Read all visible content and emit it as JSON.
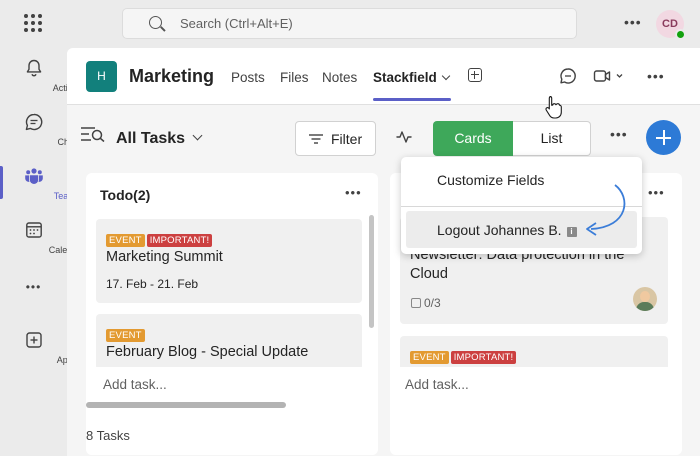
{
  "topbar": {
    "search_placeholder": "Search (Ctrl+Alt+E)",
    "more_label": "•••",
    "user_initials": "CD"
  },
  "rail": {
    "items": [
      {
        "label": "Activity",
        "icon": "bell-icon"
      },
      {
        "label": "Chat",
        "icon": "chat-icon"
      },
      {
        "label": "Teams",
        "icon": "teams-icon",
        "active": true
      },
      {
        "label": "Calendar",
        "icon": "calendar-icon"
      },
      {
        "label": "•••",
        "icon": "more-icon"
      },
      {
        "label": "Apps",
        "icon": "apps-icon"
      }
    ]
  },
  "header": {
    "team_initial": "H",
    "team_name": "Marketing",
    "tabs": [
      "Posts",
      "Files",
      "Notes",
      "Stackfield"
    ],
    "active_tab": "Stackfield",
    "more_label": "•••"
  },
  "toolbar": {
    "view_title": "All Tasks",
    "filter_label": "Filter",
    "cards_label": "Cards",
    "list_label": "List",
    "more_label": "•••"
  },
  "menu": {
    "item_1": "Customize Fields",
    "item_2": "Logout Johannes B.",
    "info_glyph": "i"
  },
  "columns": [
    {
      "title": "Todo(2)",
      "more_label": "•••",
      "cards": [
        {
          "badges": [
            "EVENT",
            "IMPORTANT!"
          ],
          "title": "Marketing Summit",
          "date": "17. Feb - 21. Feb"
        },
        {
          "badges": [
            "EVENT"
          ],
          "title": "February Blog - Special Update"
        }
      ],
      "add_task": "Add task..."
    },
    {
      "title": "",
      "more_label": "•••",
      "cards": [
        {
          "title_line_1": "Newsletter: Data protection in the",
          "title_line_2": "Cloud",
          "subtasks": "0/3"
        },
        {
          "badges": [
            "EVENT",
            "IMPORTANT!"
          ]
        }
      ],
      "add_task": "Add task..."
    }
  ],
  "footer": {
    "task_count": "8 Tasks"
  },
  "colors": {
    "accent": "#5b5fc7",
    "cards_green": "#3ea85a",
    "fab_blue": "#2d7ad6",
    "team_teal": "#12807c",
    "event_badge": "#e39a31",
    "important_badge": "#cc4040"
  }
}
